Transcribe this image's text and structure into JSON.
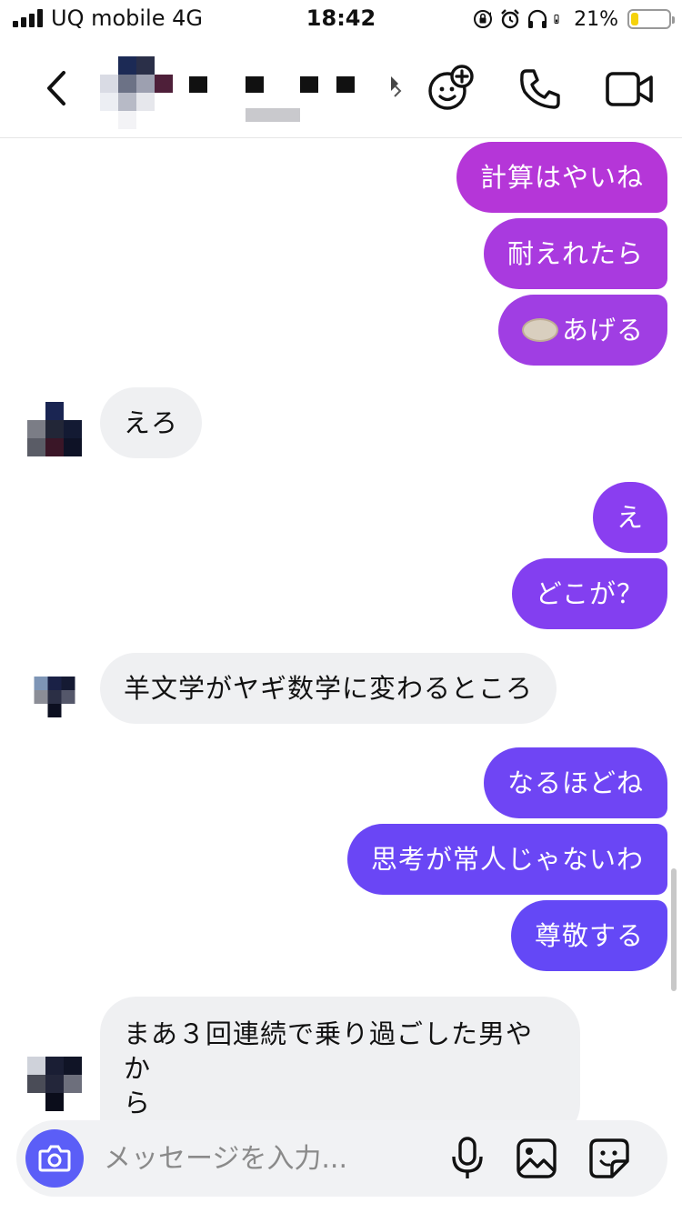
{
  "status_bar": {
    "carrier": "UQ mobile   4G",
    "time": "18:42",
    "battery_percent_text": "21%",
    "battery_level": 0.21,
    "icons": [
      "signal-icon",
      "screen-rotation-lock-icon",
      "alarm-icon",
      "headphones-icon",
      "battery-icon"
    ]
  },
  "header": {
    "icons": [
      "back-chevron-icon",
      "effects-icon",
      "phone-icon",
      "video-camera-icon"
    ]
  },
  "messages": [
    {
      "side": "sent",
      "text": "計算はやいね",
      "color": "#b536d8"
    },
    {
      "side": "sent",
      "text": "耐えれたら",
      "color": "#a93adf"
    },
    {
      "side": "sent",
      "emoji": "bread-emoji",
      "text": "あげる",
      "color": "#a03ee3"
    },
    {
      "side": "received",
      "text": "えろ"
    },
    {
      "side": "sent",
      "text": "え",
      "color": "#8a3ef0"
    },
    {
      "side": "sent",
      "text": "どこが？",
      "color": "#833ff0"
    },
    {
      "side": "received",
      "text": "羊文学がヤギ数学に変わるところ"
    },
    {
      "side": "sent",
      "text": "なるほどね",
      "color": "#6f45f4"
    },
    {
      "side": "sent",
      "text": "思考が常人じゃないわ",
      "color": "#6a46f5"
    },
    {
      "side": "sent",
      "text": "尊敬する",
      "color": "#6448f6"
    },
    {
      "side": "received",
      "text": "まあ３回連続で乗り過ごした男やか",
      "text_line2": "ら"
    }
  ],
  "composer": {
    "placeholder": "メッセージを入力...",
    "icons": [
      "camera-icon",
      "microphone-icon",
      "image-icon",
      "sticker-icon"
    ],
    "accent_color": "#5b5ef7"
  }
}
